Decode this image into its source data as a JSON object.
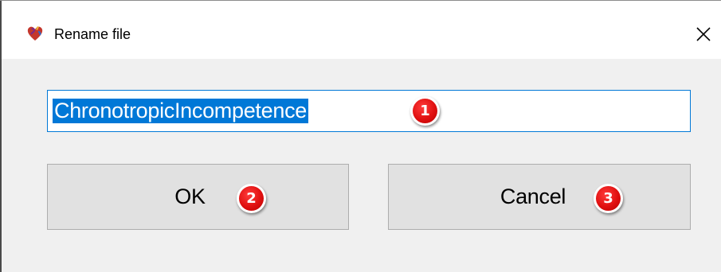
{
  "dialog": {
    "title": "Rename file",
    "icon": "app-heart-icon",
    "close_icon": "close-icon"
  },
  "name_field": {
    "value": "ChronotropicIncompetence",
    "selected": true
  },
  "buttons": {
    "ok_label": "OK",
    "cancel_label": "Cancel"
  },
  "markers": [
    "1",
    "2",
    "3"
  ],
  "colors": {
    "selection": "#0078d7",
    "marker": "#e01010",
    "button_face": "#e1e1e1"
  }
}
